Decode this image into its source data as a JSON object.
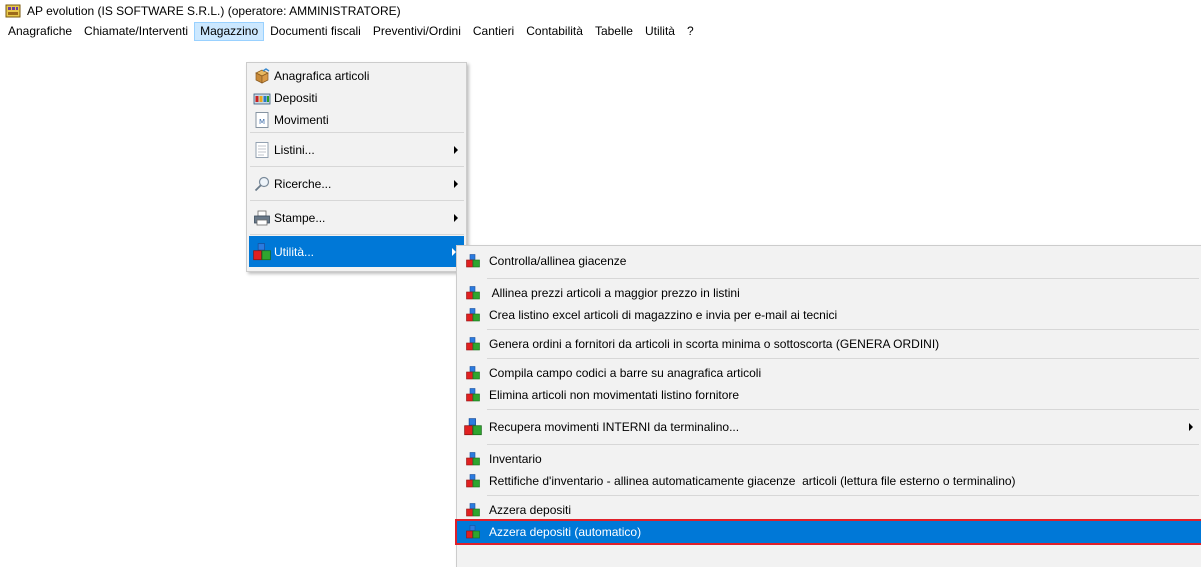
{
  "window": {
    "title": "AP evolution  (IS SOFTWARE S.R.L.) (operatore: AMMINISTRATORE)",
    "icon": "ap-app-icon"
  },
  "menubar": {
    "items": [
      {
        "label": "Anagrafiche"
      },
      {
        "label": "Chiamate/Interventi"
      },
      {
        "label": "Magazzino",
        "open": true
      },
      {
        "label": "Documenti fiscali"
      },
      {
        "label": "Preventivi/Ordini"
      },
      {
        "label": "Cantieri"
      },
      {
        "label": "Contabilità"
      },
      {
        "label": "Tabelle"
      },
      {
        "label": "Utilità"
      },
      {
        "label": "?"
      }
    ]
  },
  "magazzino_menu": {
    "items": [
      {
        "label": "Anagrafica articoli",
        "icon": "box-icon"
      },
      {
        "label": "Depositi",
        "icon": "warehouse-icon"
      },
      {
        "label": "Movimenti",
        "icon": "document-m-icon"
      },
      {
        "label": "Listini...",
        "icon": "list-icon",
        "submenu": true
      },
      {
        "label": "Ricerche...",
        "icon": "magnifier-icon",
        "submenu": true
      },
      {
        "label": "Stampe...",
        "icon": "printer-icon",
        "submenu": true
      },
      {
        "label": "Utilità...",
        "icon": "blocks-icon",
        "submenu": true,
        "selected": true
      }
    ]
  },
  "utilita_menu": {
    "items": [
      {
        "label": "Controlla/allinea giacenze"
      },
      {
        "label": " Allinea prezzi articoli a maggior prezzo in listini"
      },
      {
        "label": "Crea listino excel articoli di magazzino e invia per e-mail ai tecnici"
      },
      {
        "label": "Genera ordini a fornitori da articoli in scorta minima o sottoscorta (GENERA ORDINI)"
      },
      {
        "label": "Compila campo codici a barre su anagrafica articoli"
      },
      {
        "label": "Elimina articoli non movimentati listino fornitore"
      },
      {
        "label": "Recupera movimenti INTERNI da terminalino...",
        "submenu": true
      },
      {
        "label": "Inventario"
      },
      {
        "label": "Rettifiche d'inventario - allinea automaticamente giacenze  articoli (lettura file esterno o terminalino)"
      },
      {
        "label": "Azzera depositi"
      },
      {
        "label": "Azzera depositi (automatico)",
        "selected": true
      }
    ]
  },
  "colors": {
    "menu_bg": "#f2f2f2",
    "selection": "#0078d7",
    "menubar_open": "#cce8ff",
    "highlight_border": "#e0202a"
  }
}
